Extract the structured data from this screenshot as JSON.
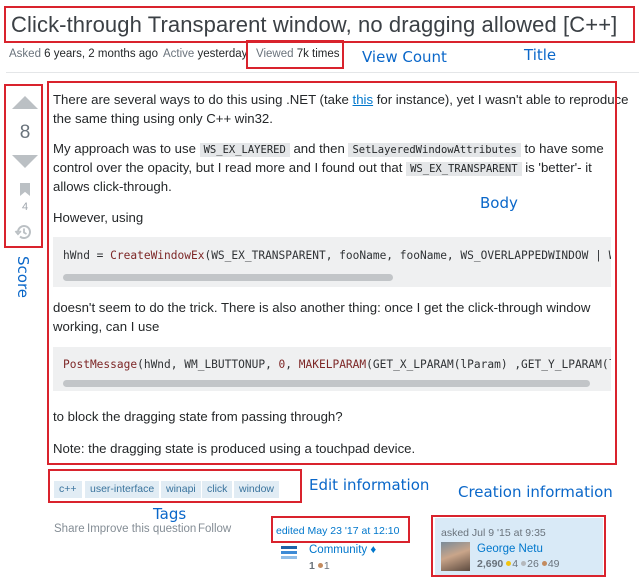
{
  "question": {
    "title": "Click-through Transparent window, no dragging allowed [C++]",
    "asked_label": "Asked",
    "asked_value": "6 years, 2 months ago",
    "active_label": "Active",
    "active_value": "yesterday",
    "viewed_label": "Viewed",
    "viewed_value": "7k times"
  },
  "vote": {
    "score": "8",
    "bookmarks": "4"
  },
  "body": {
    "p1_before_link": "There are several ways to do this using .NET (take ",
    "p1_link": "this",
    "p1_after_link": " for instance), yet I wasn't able to reproduce",
    "p1_line2": "the same thing using only C++ win32.",
    "p2_a": "My approach was to use ",
    "p2_code1": "WS_EX_LAYERED",
    "p2_b": " and then ",
    "p2_code2": "SetLayeredWindowAttributes",
    "p2_c": " to have some",
    "p2_line2_a": "control over the opacity, but I read more and I found out that ",
    "p2_code3": "WS_EX_TRANSPARENT",
    "p2_line2_b": " is 'better'- it",
    "p2_line3": "allows click-through.",
    "p3": "However, using",
    "code1": {
      "var": "hWnd = ",
      "fn": "CreateWindowEx",
      "args": "(WS_EX_TRANSPARENT, fooName, fooName, WS_OVERLAPPEDWINDOW | WS_POPUP |"
    },
    "p4_line1": "doesn't seem to do the trick. There is also another thing: once I get the click-through window",
    "p4_line2": "working, can I use",
    "code2": {
      "fn1": "PostMessage",
      "a1": "(hWnd, WM_LBUTTONUP, ",
      "num": "0",
      "a2": ", ",
      "fn2": "MAKELPARAM",
      "a3": "(GET_X_LPARAM(lParam) ,GET_Y_LPARAM(lParam)));"
    },
    "p5": "to block the dragging state from passing through?",
    "p6": "Note: the dragging state is produced using a touchpad device."
  },
  "tags": [
    "c++",
    "user-interface",
    "winapi",
    "click",
    "window"
  ],
  "post_menu": {
    "share": "Share",
    "improve": "Improve this question",
    "follow": "Follow"
  },
  "edit": {
    "edited": "edited May 23 '17 at 12:10",
    "user": "Community",
    "diamond": "♦",
    "rep": "1",
    "bronze": "1"
  },
  "owner": {
    "asked": "asked Jul 9 '15 at 9:35",
    "name": "George Netu",
    "rep": "2,690",
    "gold": "4",
    "silver": "26",
    "bronze": "49"
  },
  "annotations": {
    "view_count": "View Count",
    "title": "Title",
    "body": "Body",
    "score": "Score",
    "edit_information": "Edit information",
    "creation_information": "Creation information",
    "tags": "Tags"
  },
  "colors": {
    "annotation_box": "#d9232d",
    "annotation_text": "#0a67c9",
    "link": "#0077cc",
    "tag_bg": "#e1ecf4",
    "tag_text": "#39739d",
    "owner_bg": "#d9eaf7"
  }
}
